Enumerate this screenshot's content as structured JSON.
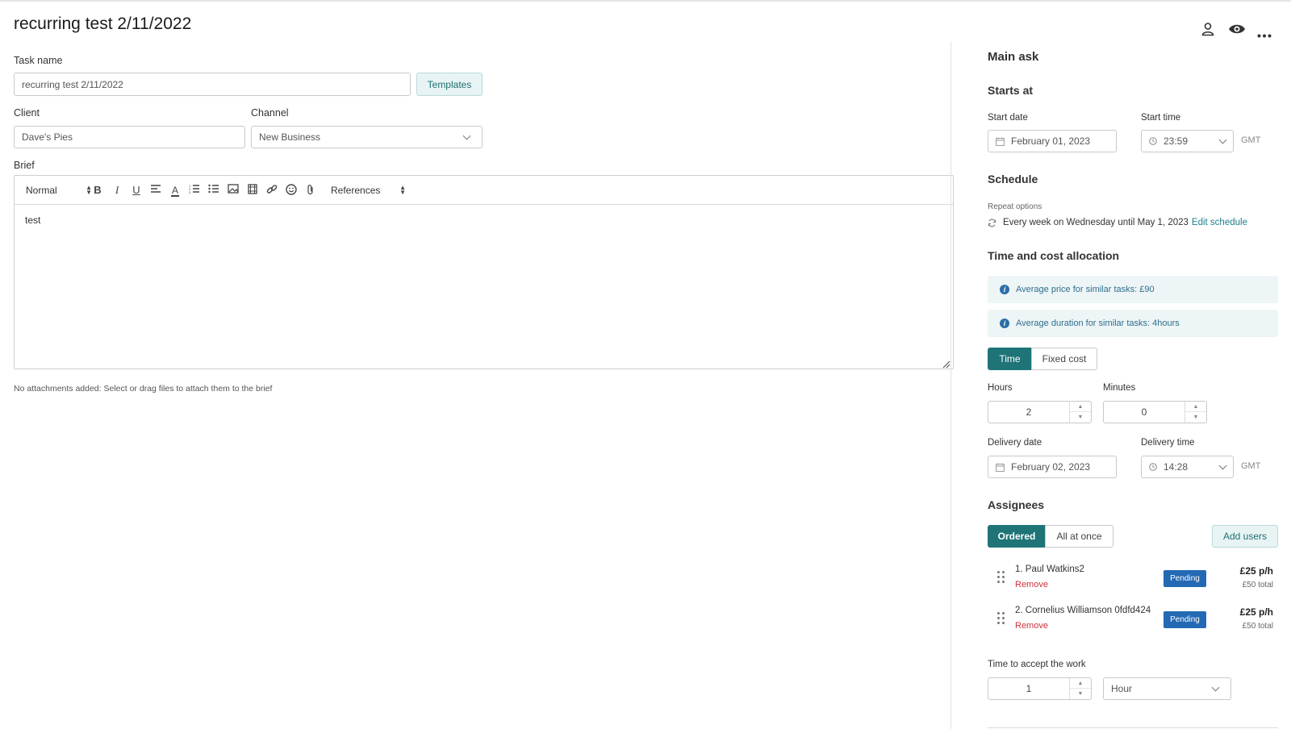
{
  "page": {
    "title": "recurring test 2/11/2022",
    "header_icons": [
      "user-icon",
      "eye-icon",
      "more-icon"
    ]
  },
  "form": {
    "task_name_label": "Task name",
    "task_name_value": "recurring test 2/11/2022",
    "templates_button": "Templates",
    "client_label": "Client",
    "client_value": "Dave's Pies",
    "channel_label": "Channel",
    "channel_value": "New Business",
    "brief_label": "Brief",
    "toolbar": {
      "format_select": "Normal",
      "references_select": "References"
    },
    "brief_text": "test",
    "attachments_note": "No attachments added: Select or drag files to attach them to the brief"
  },
  "side": {
    "main_ask": "Main ask",
    "starts_at": "Starts at",
    "start_date_label": "Start date",
    "start_date_value": "February 01, 2023",
    "start_time_label": "Start time",
    "start_time_value": "23:59",
    "tz": "GMT",
    "schedule": "Schedule",
    "repeat_options": "Repeat options",
    "repeat_text": "Every week on Wednesday until May 1, 2023",
    "edit_schedule": "Edit schedule",
    "time_cost": "Time and cost allocation",
    "avg_price": "Average price for similar tasks: £90",
    "avg_duration": "Average duration for similar tasks: 4hours",
    "mode_time": "Time",
    "mode_fixed": "Fixed cost",
    "hours_label": "Hours",
    "hours_value": "2",
    "minutes_label": "Minutes",
    "minutes_value": "0",
    "delivery_date_label": "Delivery date",
    "delivery_date_value": "February 02, 2023",
    "delivery_time_label": "Delivery time",
    "delivery_time_value": "14:28",
    "assignees": "Assignees",
    "ordered": "Ordered",
    "all_at_once": "All at once",
    "add_users": "Add users",
    "assignee_list": [
      {
        "name": "1. Paul Watkins2",
        "remove": "Remove",
        "status": "Pending",
        "rate": "£25 p/h",
        "total": "£50 total"
      },
      {
        "name": "2. Cornelius Williamson 0fdfd424",
        "remove": "Remove",
        "status": "Pending",
        "rate": "£25 p/h",
        "total": "£50 total"
      }
    ],
    "accept_label": "Time to accept the work",
    "accept_value": "1",
    "accept_unit": "Hour"
  },
  "colors": {
    "accent": "#1e7477",
    "badge": "#2369b4",
    "remove": "#d0313a",
    "link": "#1e7f8a"
  }
}
